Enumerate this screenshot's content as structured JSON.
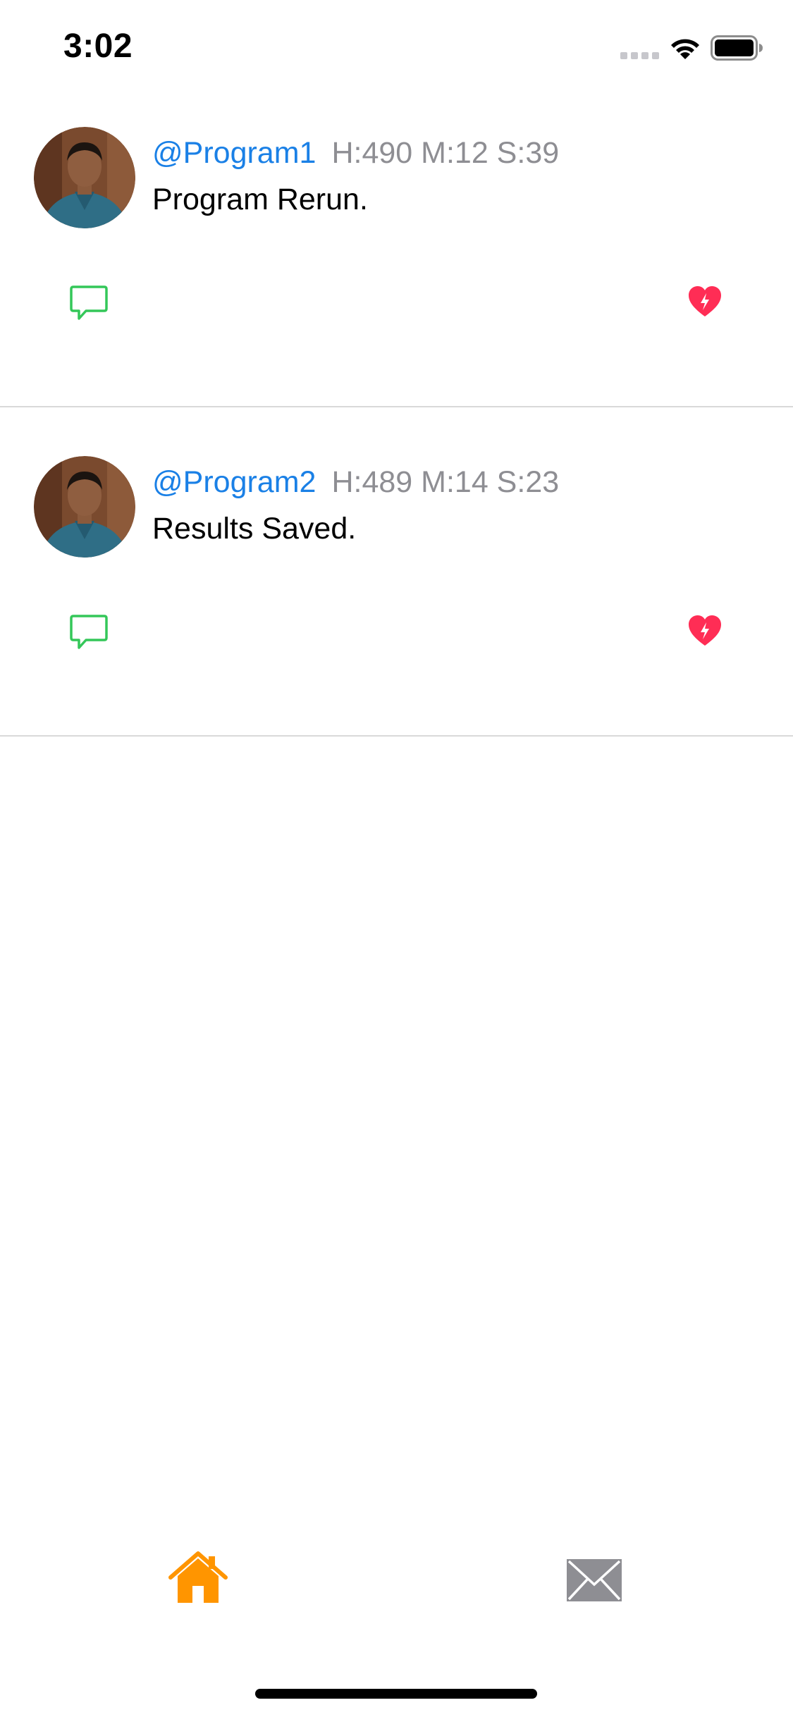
{
  "status_bar": {
    "time": "3:02"
  },
  "colors": {
    "handle": "#1a80e6",
    "timestamp": "#8e8e93",
    "comment_icon": "#34c759",
    "like_icon": "#ff2d55",
    "tab_active": "#ff9500",
    "tab_inactive": "#8e8e93"
  },
  "posts": [
    {
      "handle": "@Program1",
      "timestamp": "H:490 M:12 S:39",
      "text": "Program Rerun.",
      "icons": [
        "comment-icon",
        "heart-bolt-icon"
      ]
    },
    {
      "handle": "@Program2",
      "timestamp": "H:489 M:14 S:23",
      "text": "Results Saved.",
      "icons": [
        "comment-icon",
        "heart-bolt-icon"
      ]
    }
  ],
  "tab_bar": {
    "items": [
      {
        "icon": "home-icon",
        "active": true
      },
      {
        "icon": "mail-icon",
        "active": false
      }
    ]
  }
}
